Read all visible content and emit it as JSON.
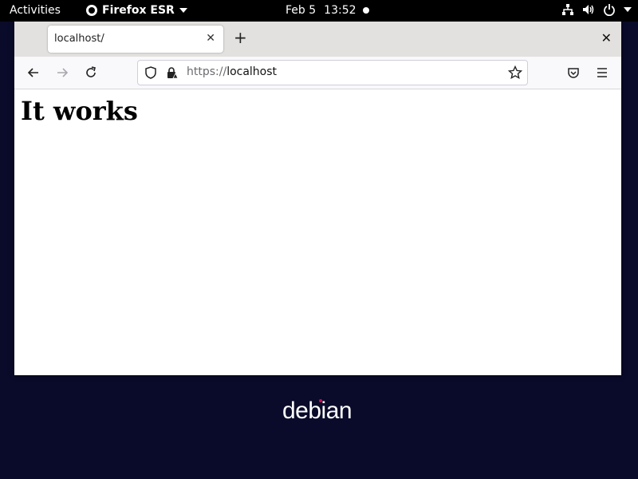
{
  "topbar": {
    "activities": "Activities",
    "app_name": "Firefox ESR",
    "date": "Feb 5",
    "time": "13:52"
  },
  "browser": {
    "tab_title": "localhost/",
    "url_scheme": "https://",
    "url_host": "localhost"
  },
  "page": {
    "heading": "It works"
  },
  "desktop": {
    "logo_text": "debian"
  },
  "icons": {
    "firefox": "firefox-icon",
    "app_menu_arrow": "chevron-down-icon",
    "network": "network-icon",
    "volume": "volume-icon",
    "power": "power-icon",
    "tab_close": "close-icon",
    "new_tab": "plus-icon",
    "window_close": "close-icon",
    "back": "back-arrow-icon",
    "forward": "forward-arrow-icon",
    "reload": "reload-icon",
    "tracking_protection": "shield-icon",
    "connection_secure": "lock-icon",
    "bookmark": "star-icon",
    "pocket": "pocket-icon",
    "menu": "hamburger-menu-icon"
  },
  "colors": {
    "desktop_background": "#0a0b2a",
    "topbar": "#000000",
    "debian_red": "#d70751"
  }
}
